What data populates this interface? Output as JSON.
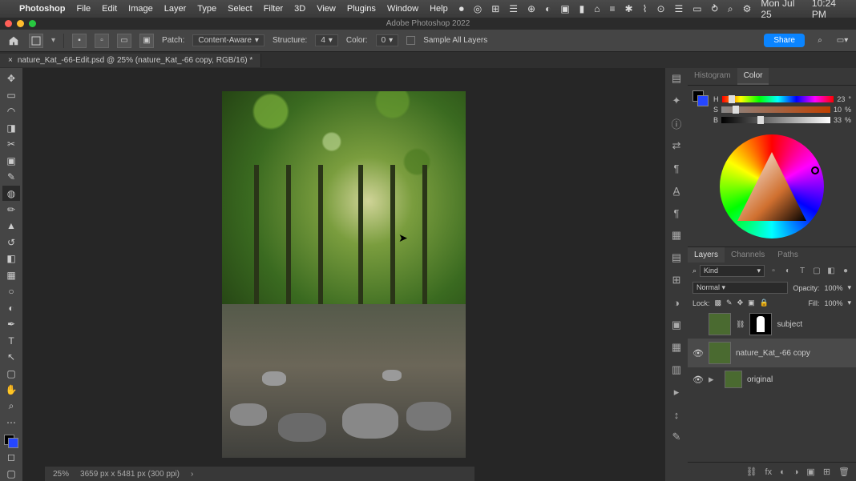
{
  "mac": {
    "app": "Photoshop",
    "menus": [
      "File",
      "Edit",
      "Image",
      "Layer",
      "Type",
      "Select",
      "Filter",
      "3D",
      "View",
      "Plugins",
      "Window",
      "Help"
    ],
    "date": "Mon Jul 25",
    "time": "10:24 PM"
  },
  "title": "Adobe Photoshop 2022",
  "options": {
    "patch_label": "Patch:",
    "patch_mode": "Content-Aware",
    "structure_label": "Structure:",
    "structure_val": "4",
    "color_label": "Color:",
    "color_val": "0",
    "sample_all": "Sample All Layers",
    "share": "Share"
  },
  "tab": {
    "label": "nature_Kat_-66-Edit.psd @ 25% (nature_Kat_-66 copy, RGB/16) *"
  },
  "color": {
    "tabs": [
      "Histogram",
      "Color"
    ],
    "h_label": "H",
    "h_val": "23",
    "s_label": "S",
    "s_val": "10",
    "b_label": "B",
    "b_val": "33",
    "pct": "%"
  },
  "layersTabs": [
    "Layers",
    "Channels",
    "Paths"
  ],
  "kind": {
    "label": "Kind"
  },
  "blend": {
    "mode": "Normal",
    "opacity_label": "Opacity:",
    "opacity": "100%",
    "fill_label": "Fill:",
    "fill": "100%"
  },
  "lock_label": "Lock:",
  "layers": [
    {
      "name": "subject"
    },
    {
      "name": "nature_Kat_-66 copy"
    },
    {
      "name": "original"
    }
  ],
  "status": {
    "zoom": "25%",
    "dim": "3659 px x 5481 px (300 ppi)"
  }
}
